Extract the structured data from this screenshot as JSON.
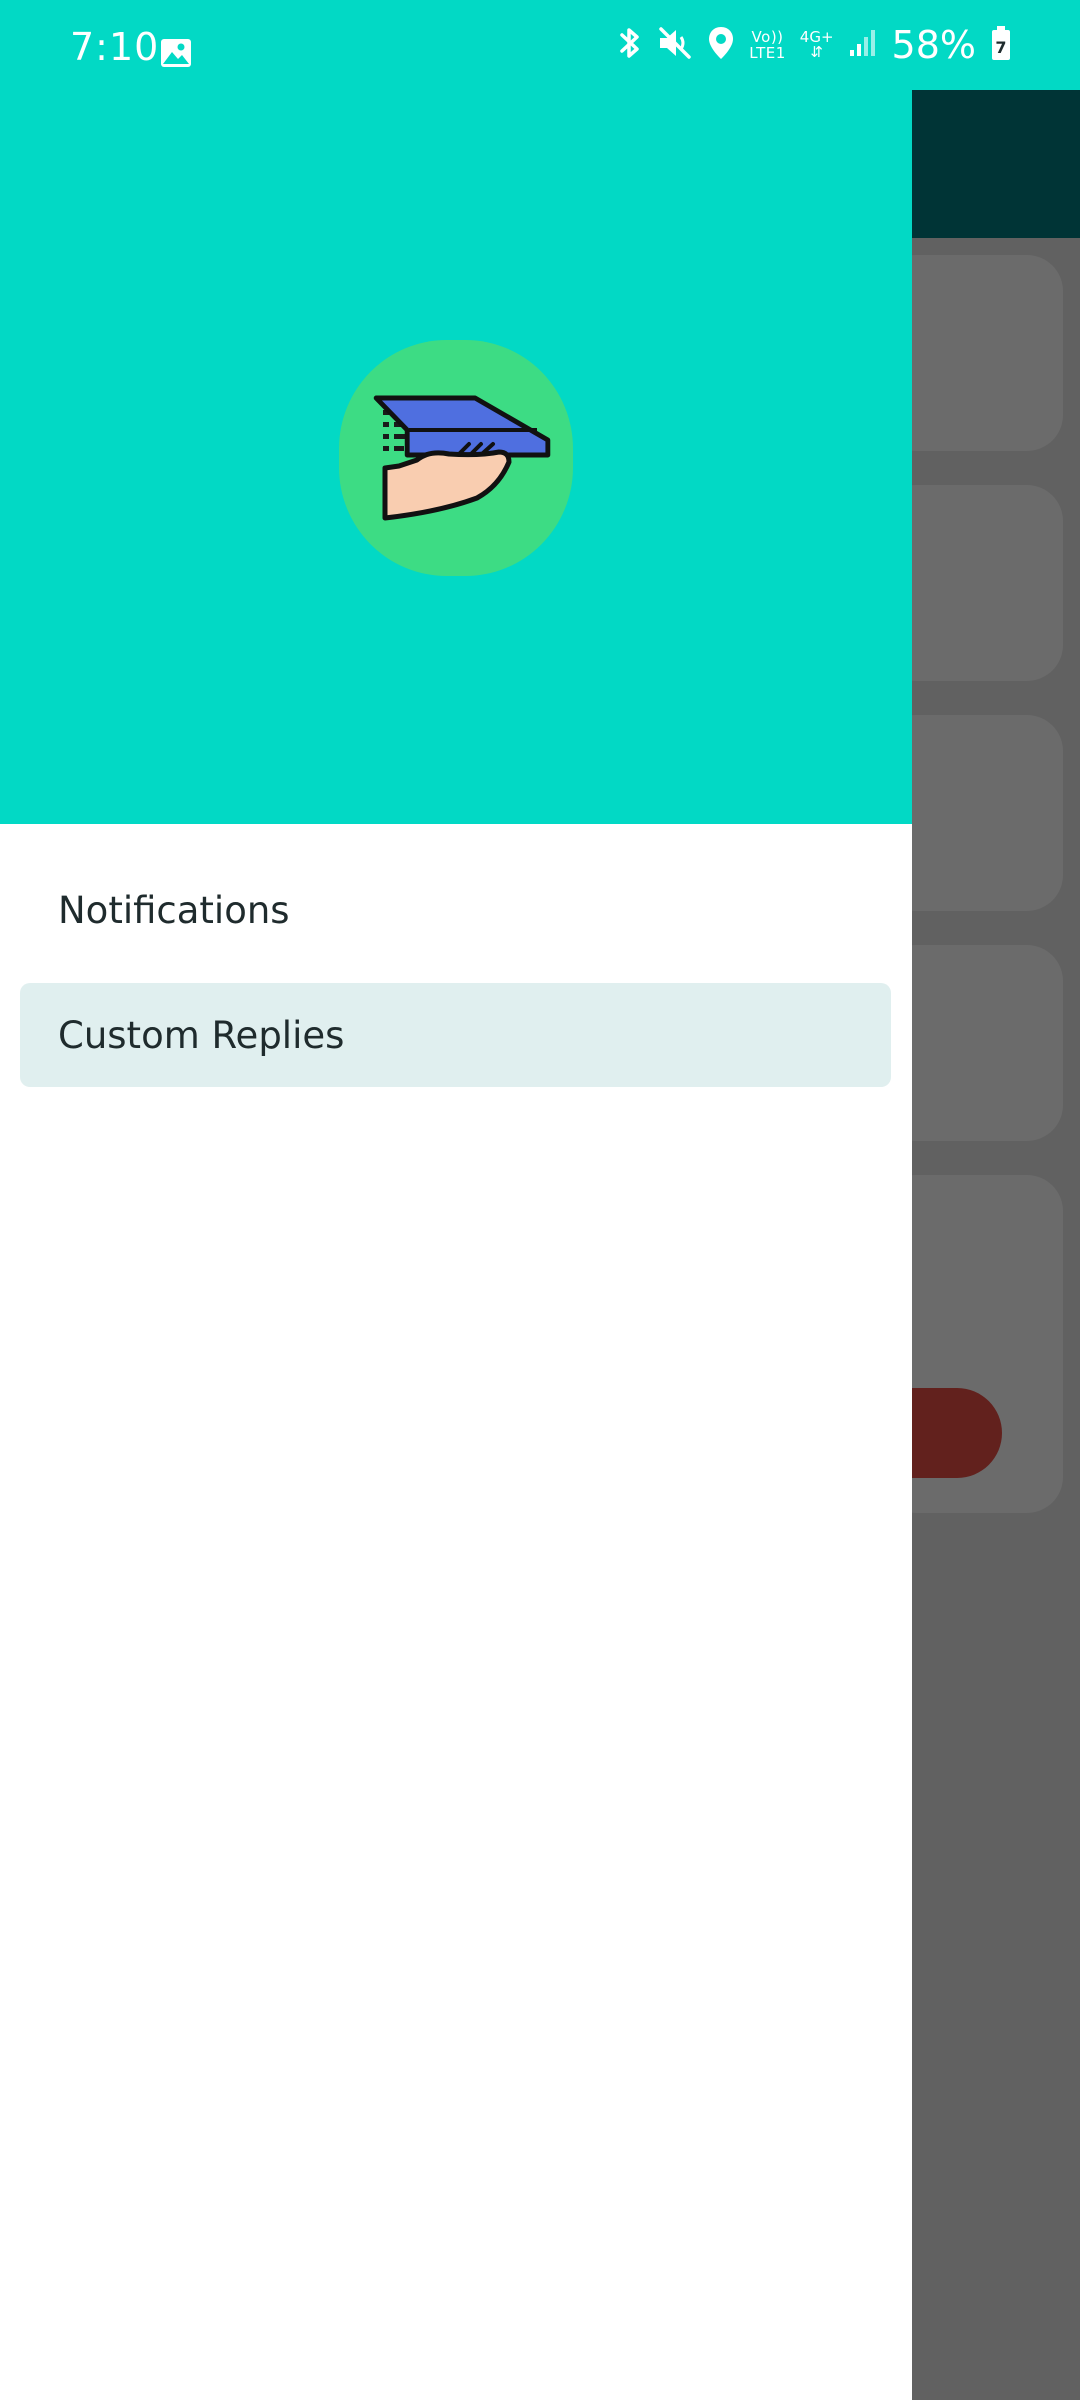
{
  "status_bar": {
    "time": "7:10",
    "volte_top": "Vo))",
    "volte_bottom": "LTE1",
    "network": "4G+",
    "battery_percent": "58%",
    "battery_badge": "7"
  },
  "drawer": {
    "logo_icon": "hand-holding-paper-plane-icon",
    "menu_items": [
      {
        "label": "Notifications",
        "selected": false
      },
      {
        "label": "Custom Replies",
        "selected": true
      }
    ]
  },
  "colors": {
    "accent": "#02d9c5",
    "toolbar": "#003436",
    "logo_bg": "#3ddc84",
    "selected_item_bg": "#e0efef",
    "scrim": "#616161",
    "action_pill": "#62211d"
  }
}
